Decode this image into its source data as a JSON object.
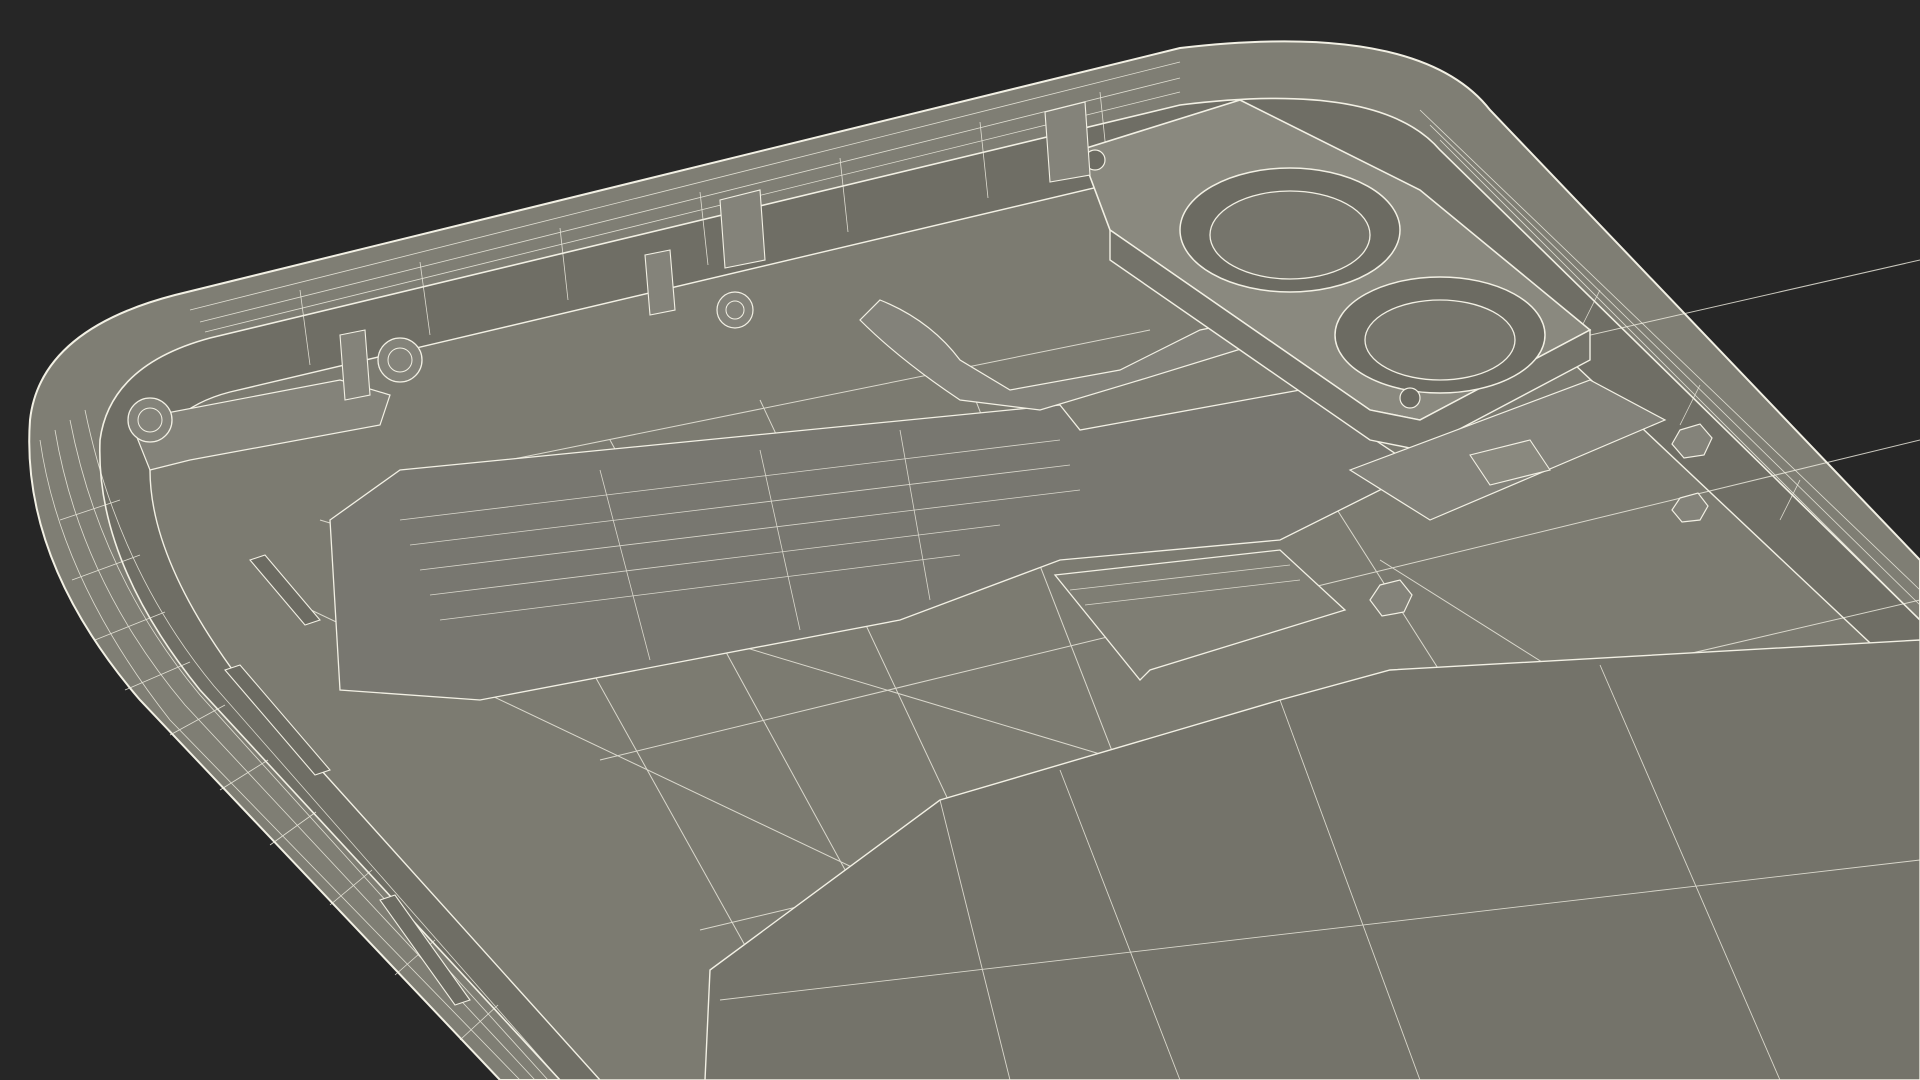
{
  "scene": {
    "colors": {
      "background": "#262626",
      "shell": "#7f7e74",
      "shell_shade": "#6f6e65",
      "floor": "#7c7b71",
      "floor_dark": "#74736a",
      "camera_housing": "#85847a",
      "wire": "#f2f0e4",
      "wire_dim": "#d9d7cb"
    }
  }
}
